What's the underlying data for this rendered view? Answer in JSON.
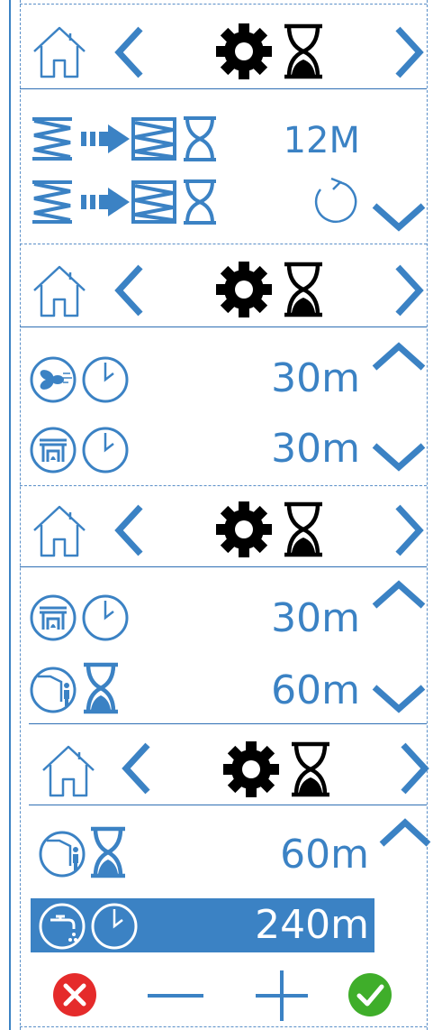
{
  "colors": {
    "accent": "#3b82c4",
    "dark": "#000000",
    "cancel": "#e52b2b",
    "confirm": "#3fae2a"
  },
  "icons": [
    "home-icon",
    "chevron-left-icon",
    "gear-icon",
    "hourglass-icon",
    "chevron-right-icon",
    "chevron-up-icon",
    "chevron-down-icon",
    "filter-transfer-icon",
    "refresh-icon",
    "fan-icon",
    "clock-icon",
    "fireplace-icon",
    "occupancy-icon",
    "tap-icon",
    "cancel-icon",
    "minus-icon",
    "plus-icon",
    "confirm-icon"
  ],
  "screens": [
    {
      "rows": [
        {
          "value": "12M"
        },
        {
          "value": ""
        }
      ]
    },
    {
      "rows": [
        {
          "value": "30m"
        },
        {
          "value": "30m"
        }
      ]
    },
    {
      "rows": [
        {
          "value": "30m"
        },
        {
          "value": "60m"
        }
      ]
    },
    {
      "rows": [
        {
          "value": "60m"
        },
        {
          "value": "240m",
          "selected": true
        }
      ]
    }
  ]
}
